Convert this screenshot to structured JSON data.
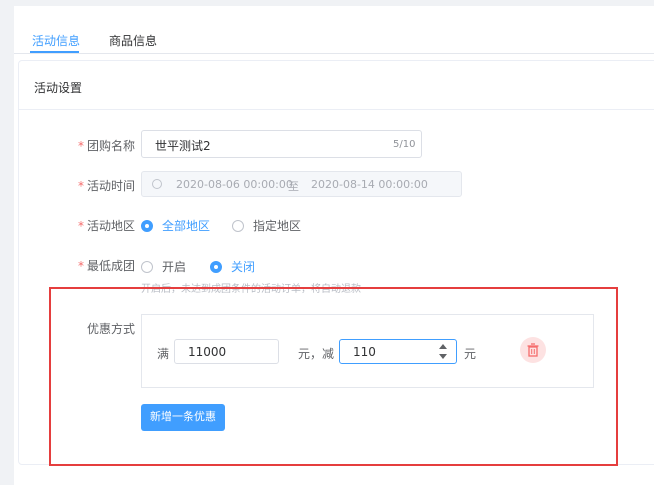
{
  "tabs": [
    {
      "label": "活动信息",
      "active": true
    },
    {
      "label": "商品信息",
      "active": false
    }
  ],
  "card": {
    "title": "活动设置"
  },
  "form": {
    "name": {
      "label": "团购名称",
      "value": "世平测试2",
      "counter": "5/10"
    },
    "time": {
      "label": "活动时间",
      "start": "2020-08-06 00:00:00",
      "separator": "至",
      "end": "2020-08-14 00:00:00"
    },
    "region": {
      "label": "活动地区",
      "options": [
        "全部地区",
        "指定地区"
      ],
      "selected": "全部地区"
    },
    "min_group": {
      "label": "最低成团",
      "options": [
        "开启",
        "关闭"
      ],
      "selected": "关闭",
      "hint": "开启后，未达到成团条件的活动订单，将自动退款"
    },
    "discount": {
      "label": "优惠方式",
      "prefix": "满",
      "threshold": "11000",
      "mid": "元，减",
      "reduce": "110",
      "suffix": "元"
    },
    "add_button": "新增一条优惠"
  },
  "colors": {
    "accent": "#409eff",
    "required": "#f56c6c",
    "delete": "#f56c6c",
    "highlight": "#e53e3e"
  }
}
